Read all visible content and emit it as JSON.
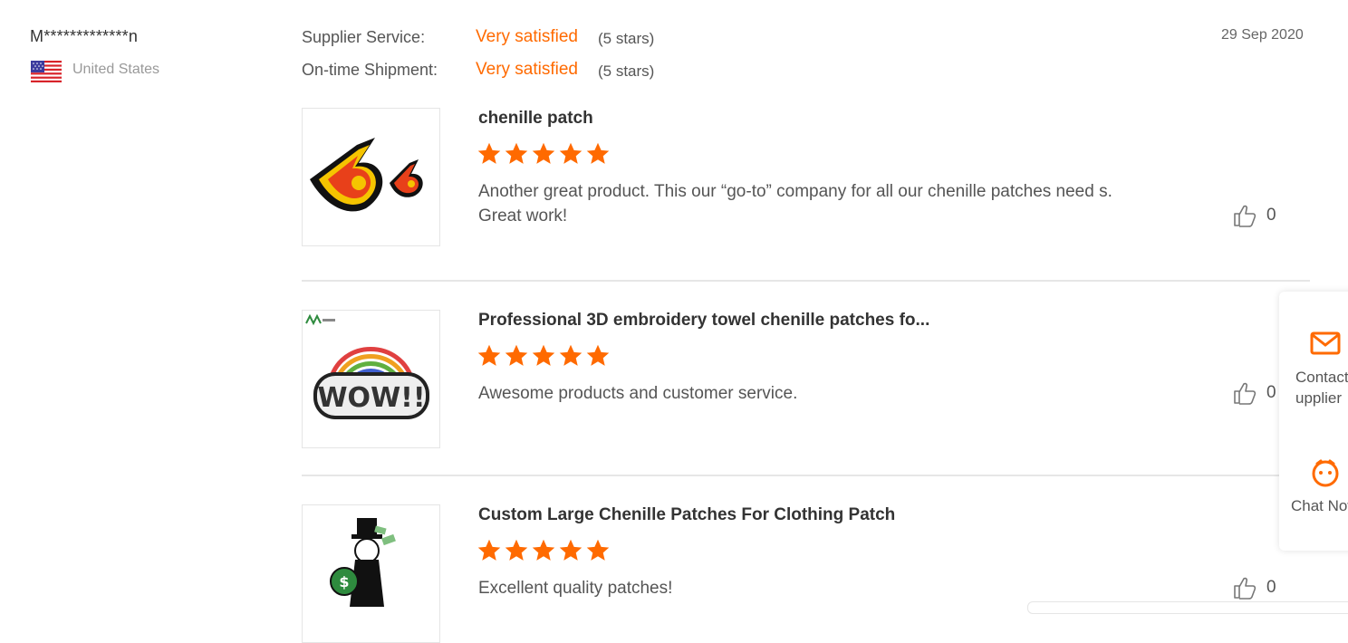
{
  "reviewer": {
    "name": "M*************n",
    "country": "United States",
    "flag_icon": "us-flag-icon"
  },
  "ratings": [
    {
      "label": "Supplier Service:",
      "value": "Very satisfied",
      "stars": "(5 stars)"
    },
    {
      "label": "On-time Shipment:",
      "value": "Very satisfied",
      "stars": "(5 stars)"
    }
  ],
  "review_date": "29 Sep 2020",
  "accent_color": "#ff6a00",
  "products": [
    {
      "title": "chenille patch",
      "rating": 5,
      "comment": "Another great product. This our “go-to” company for all our chenille patches need s. Great work!",
      "likes": "0"
    },
    {
      "title": "Professional 3D embroidery towel chenille patches fo...",
      "rating": 5,
      "comment": "Awesome products and customer service.",
      "likes": "0"
    },
    {
      "title": "Custom Large Chenille Patches For Clothing Patch",
      "rating": 5,
      "comment": "Excellent quality patches!",
      "likes": "0"
    }
  ],
  "float_panel": {
    "contact_label": "Contact Supplier",
    "chat_label": "Chat Now"
  }
}
